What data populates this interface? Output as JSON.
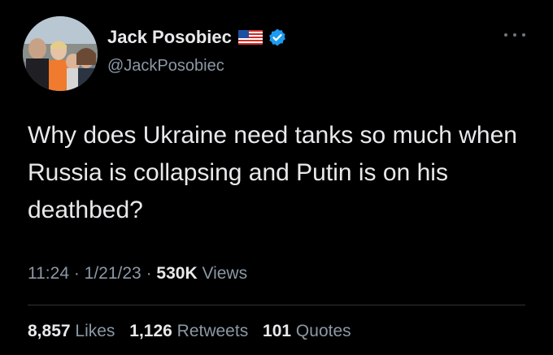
{
  "author": {
    "display_name": "Jack Posobiec",
    "handle": "@JackPosobiec"
  },
  "tweet": {
    "text": "Why does Ukraine need tanks so much when Russia is collapsing and Putin is on his deathbed?"
  },
  "meta": {
    "time": "11:24",
    "sep1": " · ",
    "date": "1/21/23",
    "sep2": " · ",
    "views_count": "530K",
    "views_label": " Views"
  },
  "stats": {
    "likes_count": "8,857",
    "likes_label": " Likes",
    "retweets_count": "1,126",
    "retweets_label": " Retweets",
    "quotes_count": "101",
    "quotes_label": " Quotes"
  },
  "icons": {
    "flag": "us-flag-icon",
    "verified": "verified-badge-icon",
    "more": "more-options-icon"
  },
  "colors": {
    "background": "#000000",
    "text": "#e7e9ea",
    "secondary": "#8b98a5",
    "verified": "#1d9bf0",
    "divider": "#2f3336"
  }
}
